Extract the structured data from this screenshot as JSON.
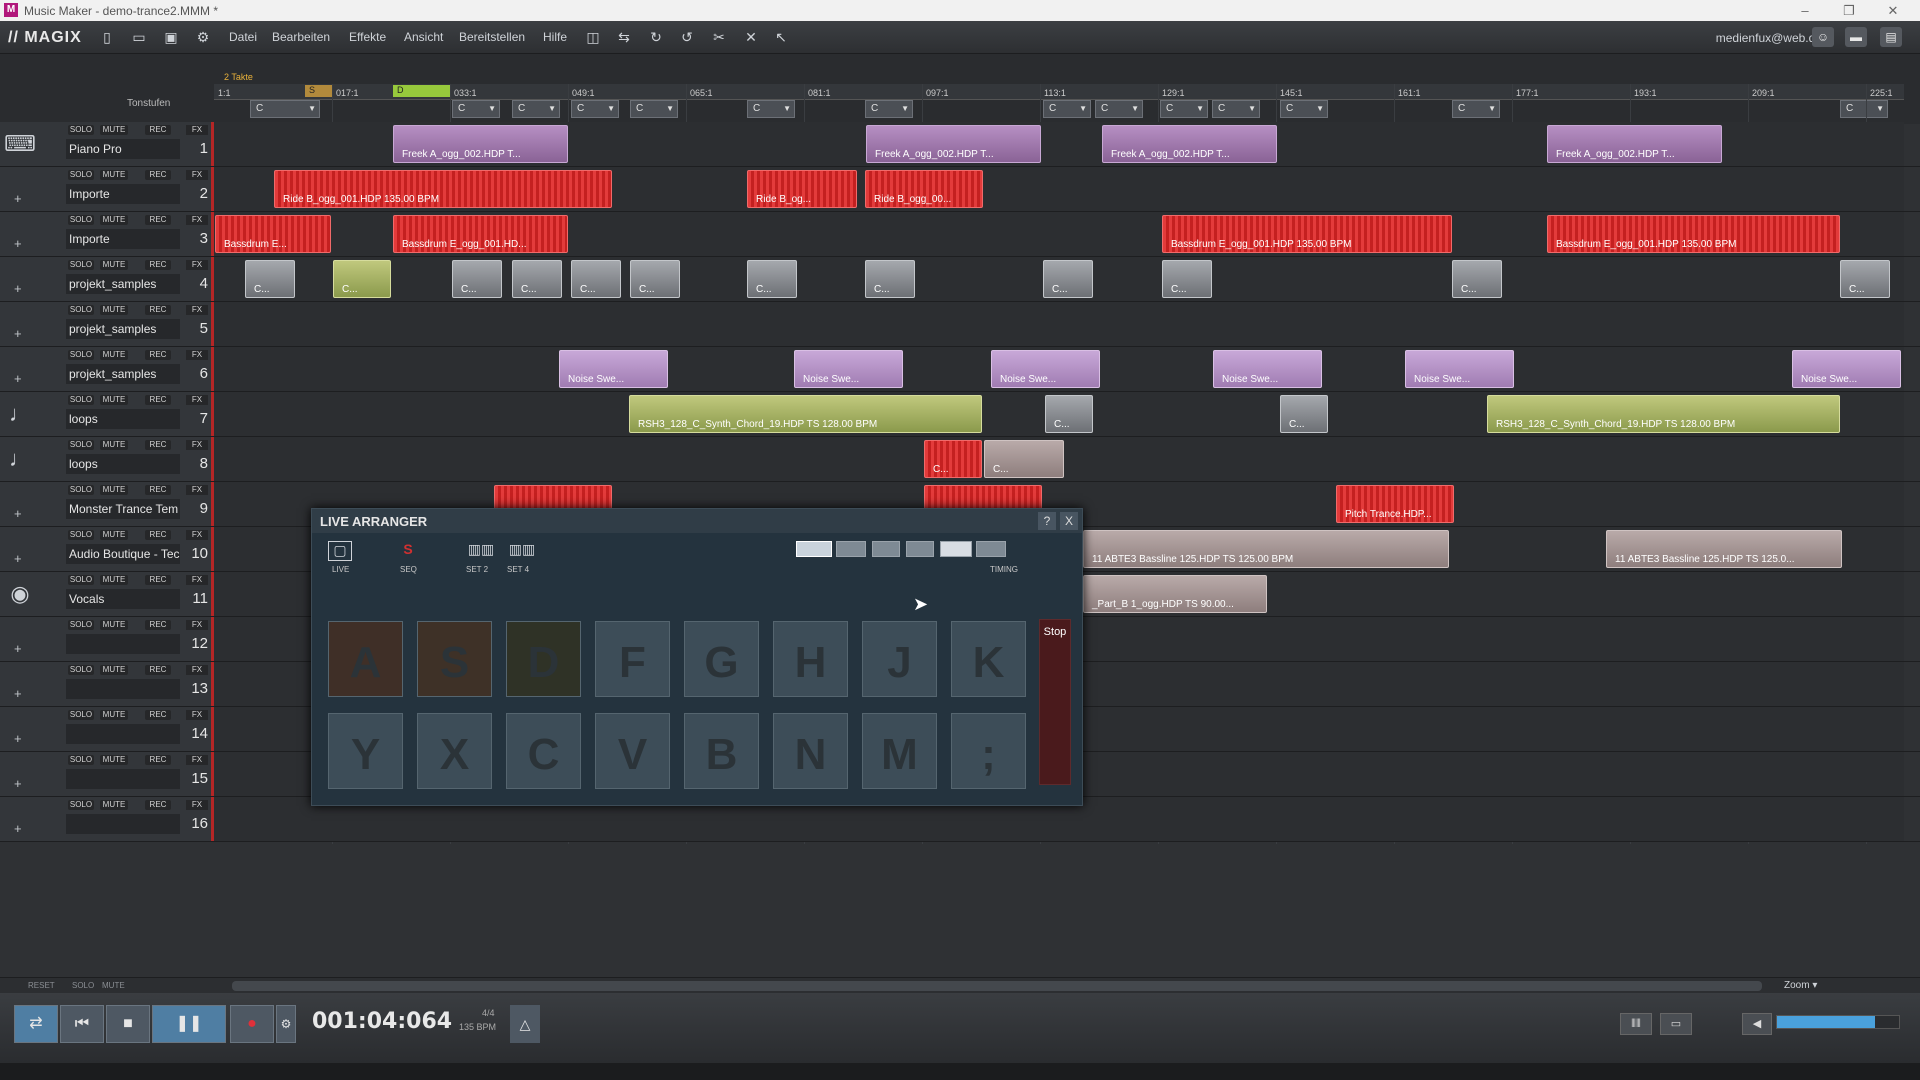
{
  "window": {
    "title": "Music Maker - demo-trance2.MMM *",
    "minimize": "–",
    "maximize": "❐",
    "close": "✕"
  },
  "menubar": {
    "logo": "// MAGIX",
    "items": [
      "Datei",
      "Bearbeiten",
      "Effekte",
      "Ansicht",
      "Bereitstellen",
      "Hilfe"
    ],
    "user_email": "medienfux@web.de"
  },
  "ruler": {
    "takte_label": "2 Takte",
    "loop_start": "S",
    "loop_end": "D",
    "tonstufen": "Tonstufen",
    "positions": [
      "1:1",
      "017:1",
      "033:1",
      "049:1",
      "065:1",
      "081:1",
      "097:1",
      "113:1",
      "129:1",
      "145:1",
      "161:1",
      "177:1",
      "193:1",
      "209:1",
      "225:1"
    ],
    "chord_value": "C"
  },
  "tracks": [
    {
      "name": "Piano Pro",
      "num": "1",
      "icon": "keyboard-icon"
    },
    {
      "name": "Importe",
      "num": "2",
      "icon": "plus-icon"
    },
    {
      "name": "Importe",
      "num": "3",
      "icon": "plus-icon"
    },
    {
      "name": "projekt_samples",
      "num": "4",
      "icon": "plus-icon"
    },
    {
      "name": "projekt_samples",
      "num": "5",
      "icon": "plus-icon"
    },
    {
      "name": "projekt_samples",
      "num": "6",
      "icon": "plus-icon"
    },
    {
      "name": "loops",
      "num": "7",
      "icon": "note-icon"
    },
    {
      "name": "loops",
      "num": "8",
      "icon": "note-icon"
    },
    {
      "name": "Monster Trance Tem",
      "num": "9",
      "icon": "plus-icon"
    },
    {
      "name": "Audio Boutique - Tec",
      "num": "10",
      "icon": "plus-icon"
    },
    {
      "name": "Vocals",
      "num": "11",
      "icon": "mic-icon"
    },
    {
      "name": "",
      "num": "12",
      "icon": "plus-icon"
    },
    {
      "name": "",
      "num": "13",
      "icon": "plus-icon"
    },
    {
      "name": "",
      "num": "14",
      "icon": "plus-icon"
    },
    {
      "name": "",
      "num": "15",
      "icon": "plus-icon"
    },
    {
      "name": "",
      "num": "16",
      "icon": "plus-icon"
    }
  ],
  "track_buttons": {
    "solo": "SOLO",
    "mute": "MUTE",
    "rec": "REC",
    "fx": "FX"
  },
  "objects": {
    "freek": "Freek A_ogg_002.HDP  T...",
    "ride": "Ride B_ogg_001.HDP  135.00 BPM",
    "ride_short": "Ride B_og...",
    "ride_short2": "Ride B_ogg_00...",
    "bassdrum_short": "Bassdrum E...",
    "bassdrum_mid": "Bassdrum E_ogg_001.HD...",
    "bassdrum_full": "Bassdrum E_ogg_001.HDP  135.00 BPM",
    "noise": "Noise Swe...",
    "synth": "RSH3_128_C_Synth_Chord_19.HDP  TS  128.00 BPM",
    "pitch": "Pitch Trance.HDP...",
    "bassline": "11 ABTE3 Bassline 125.HDP  TS  125.00 BPM",
    "bassline_short": "11 ABTE3 Bassline 125.HDP  TS  125.0...",
    "vocal": "_Part_B 1_ogg.HDP  TS  90.00...",
    "small": "C..."
  },
  "live_arranger": {
    "title": "LIVE ARRANGER",
    "help": "?",
    "close": "X",
    "modes": [
      {
        "label": "LIVE",
        "icon": "live-icon"
      },
      {
        "label": "SEQ",
        "icon": "seq-icon"
      },
      {
        "label": "SET 2",
        "icon": "set-icon"
      },
      {
        "label": "SET 4",
        "icon": "set-icon"
      }
    ],
    "timing_label": "TIMING",
    "row1": [
      "A",
      "S",
      "D",
      "F",
      "G",
      "H",
      "J",
      "K"
    ],
    "row2": [
      "Y",
      "X",
      "C",
      "V",
      "B",
      "N",
      "M",
      ";"
    ],
    "stop": "Stop"
  },
  "scrollbar": {
    "reset": "RESET",
    "solo": "SOLO",
    "mute": "MUTE",
    "zoom": "Zoom ▾"
  },
  "transport": {
    "time": "001:04:064",
    "signature": "4/4",
    "bpm": "135 BPM"
  },
  "colors": {
    "accent_red": "#b42626",
    "accent_blue": "#4aa1dc",
    "record": "#e0303a"
  }
}
